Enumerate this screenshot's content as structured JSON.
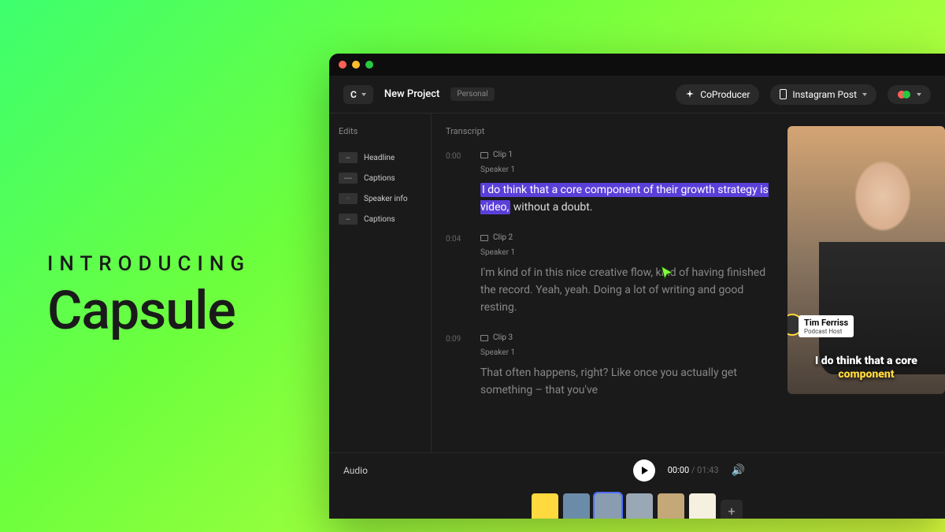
{
  "hero": {
    "intro": "INTRODUCING",
    "title": "Capsule"
  },
  "toolbar": {
    "workspace_letter": "C",
    "project_name": "New Project",
    "project_badge": "Personal",
    "coproducer_label": "CoProducer",
    "format_label": "Instagram Post"
  },
  "sidebar": {
    "header": "Edits",
    "items": [
      {
        "label": "Headline"
      },
      {
        "label": "Captions"
      },
      {
        "label": "Speaker info"
      },
      {
        "label": "Captions"
      }
    ]
  },
  "transcript": {
    "header": "Transcript",
    "clips": [
      {
        "ts": "0:00",
        "label": "Clip 1",
        "speaker": "Speaker 1",
        "text_hl": "I do think that a core component of their growth strategy is video,",
        "text_rest": " without a doubt."
      },
      {
        "ts": "0:04",
        "label": "Clip 2",
        "speaker": "Speaker 1",
        "text": "I'm kind of in this nice creative flow, kind of having finished the record. Yeah, yeah. Doing a lot of writing and good resting."
      },
      {
        "ts": "0:09",
        "label": "Clip 3",
        "speaker": "Speaker 1",
        "text": "That often happens, right? Like once you actually get something – that you've"
      }
    ]
  },
  "preview": {
    "name": "Tim Ferriss",
    "role": "Podcast Host",
    "caption_pre": "I do think that a core ",
    "caption_hl": "component"
  },
  "audio": {
    "label": "Audio",
    "current": "00:00",
    "sep": "/",
    "duration": "01:43"
  },
  "clipstrip": {
    "count": 6,
    "selected_index": 2,
    "add_label": "+"
  }
}
